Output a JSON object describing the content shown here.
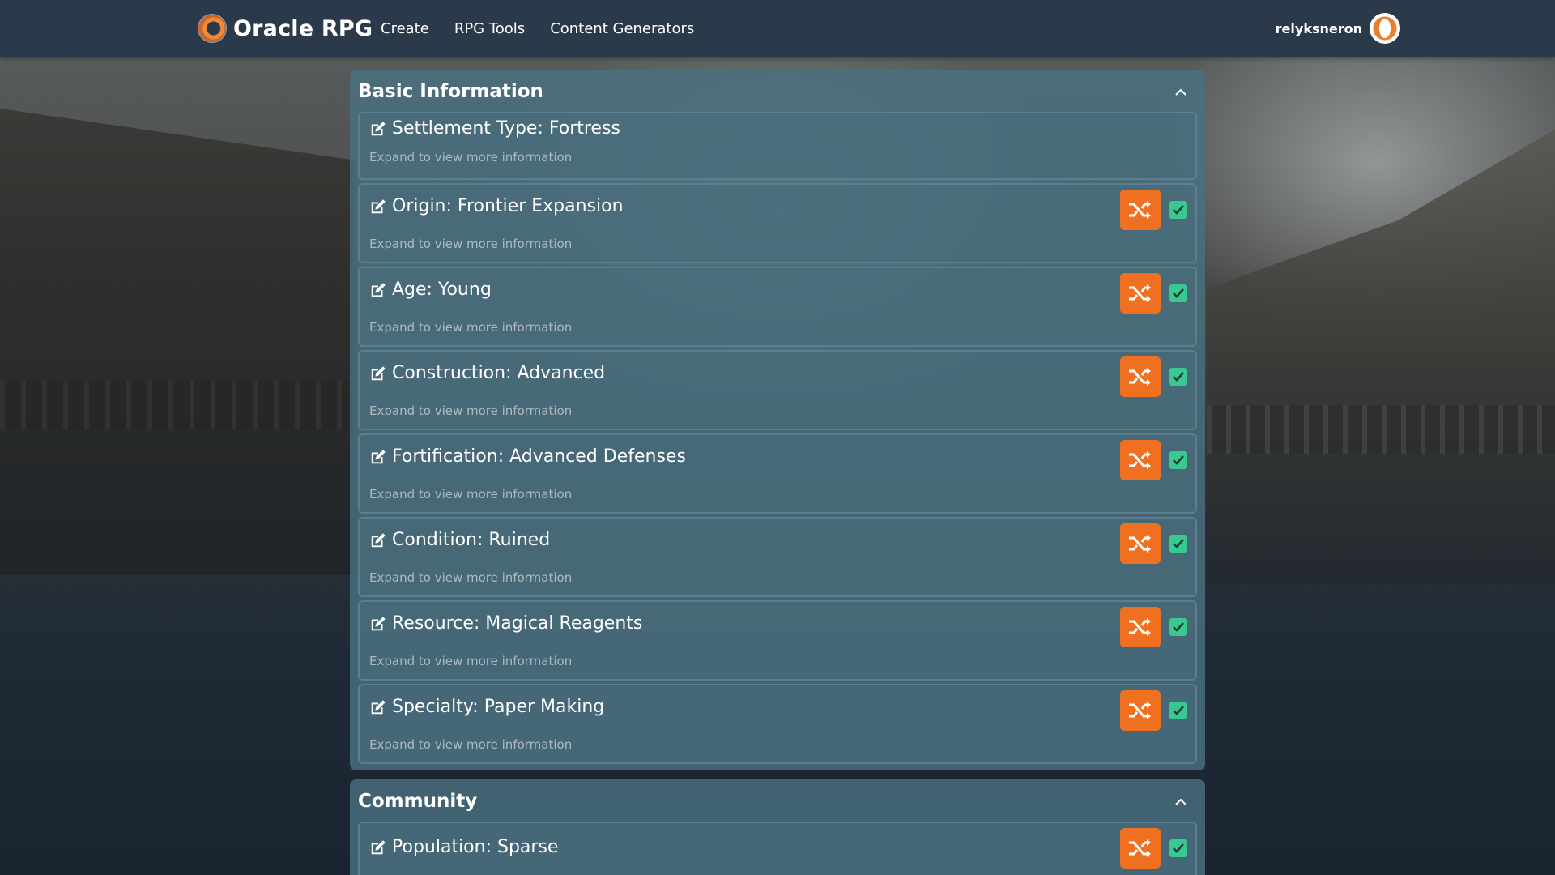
{
  "brand": {
    "name": "Oracle RPG",
    "logo_icon": "oracle-ring-logo"
  },
  "nav": {
    "links": [
      "Create",
      "RPG Tools",
      "Content Generators"
    ]
  },
  "user": {
    "name": "relyksneron"
  },
  "colors": {
    "navbar": "#2b3a4a",
    "panel": "#4a7080",
    "shuffle_button": "#f07022",
    "checkbox": "#37c98f"
  },
  "sections": [
    {
      "title": "Basic Information",
      "expanded": true,
      "items": [
        {
          "label": "Settlement Type: Fortress",
          "subtitle": "Expand to view more information",
          "has_controls": false
        },
        {
          "label": "Origin: Frontier Expansion",
          "subtitle": "Expand to view more information",
          "has_controls": true,
          "checked": true
        },
        {
          "label": "Age: Young",
          "subtitle": "Expand to view more information",
          "has_controls": true,
          "checked": true
        },
        {
          "label": "Construction: Advanced",
          "subtitle": "Expand to view more information",
          "has_controls": true,
          "checked": true
        },
        {
          "label": "Fortification: Advanced Defenses",
          "subtitle": "Expand to view more information",
          "has_controls": true,
          "checked": true
        },
        {
          "label": "Condition: Ruined",
          "subtitle": "Expand to view more information",
          "has_controls": true,
          "checked": true
        },
        {
          "label": "Resource: Magical Reagents",
          "subtitle": "Expand to view more information",
          "has_controls": true,
          "checked": true
        },
        {
          "label": "Specialty: Paper Making",
          "subtitle": "Expand to view more information",
          "has_controls": true,
          "checked": true
        }
      ]
    },
    {
      "title": "Community",
      "expanded": true,
      "items": [
        {
          "label": "Population: Sparse",
          "has_controls": true,
          "checked": true
        }
      ]
    }
  ]
}
